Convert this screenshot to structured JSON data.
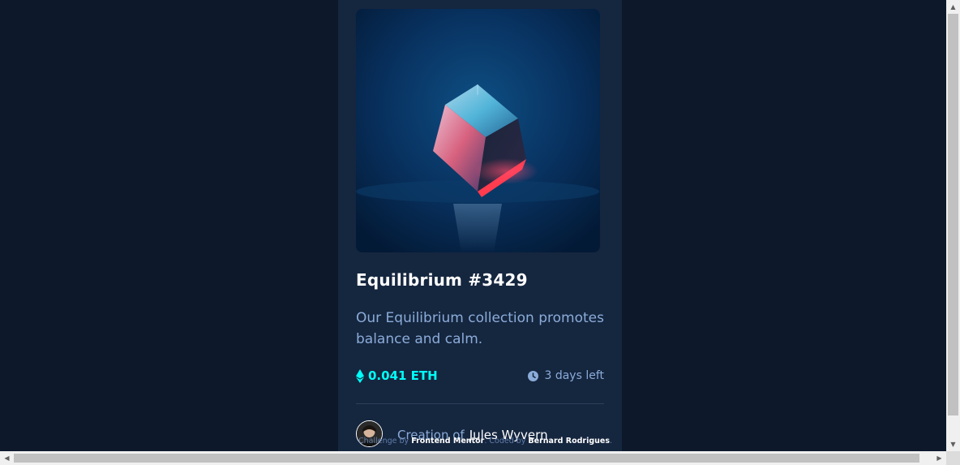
{
  "card": {
    "image_alt": "Equilibrium",
    "title": "Equilibrium #3429",
    "description": "Our Equilibrium collection promotes balance and calm.",
    "price": "0.041 ETH",
    "time_left": "3 days left",
    "creation_prefix": "Creation of",
    "creator": "Jules Wyvern"
  },
  "attribution": {
    "challenge_prefix": "Challenge by",
    "challenge_by": "Frontend Mentor",
    "coded_prefix": ". Coded by",
    "coded_by": "Bernard Rodrigues",
    "suffix": "."
  },
  "colors": {
    "page_bg": "#0d192b",
    "card_bg": "#15263f",
    "accent_cyan": "#00fff8",
    "soft_blue": "#8bacd9",
    "white": "#ffffff"
  },
  "icons": {
    "eth": "ethereum-icon",
    "clock": "clock-icon",
    "scroll_up": "chevron-up-icon",
    "scroll_down": "chevron-down-icon",
    "scroll_left": "chevron-left-icon",
    "scroll_right": "chevron-right-icon"
  }
}
